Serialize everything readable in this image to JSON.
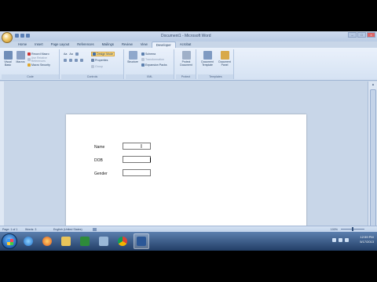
{
  "window": {
    "title": "Document1 - Microsoft Word"
  },
  "tabs": [
    "Home",
    "Insert",
    "Page Layout",
    "References",
    "Mailings",
    "Review",
    "View",
    "Developer",
    "Acrobat"
  ],
  "active_tab": "Developer",
  "ribbon": {
    "code": {
      "label": "Code",
      "visual_basic": "Visual Basic",
      "macros": "Macros",
      "record_macro": "Record Macro",
      "use_relative_references": "Use Relative References",
      "macro_security": "Macro Security"
    },
    "controls": {
      "label": "Controls",
      "design_mode": "Design Mode",
      "properties": "Properties",
      "group": "Group"
    },
    "xml": {
      "label": "XML",
      "structure": "Structure",
      "schema": "Schema",
      "transformation": "Transformation",
      "expansion_packs": "Expansion Packs"
    },
    "protect": {
      "label": "Protect",
      "protect_document": "Protect Document"
    },
    "templates": {
      "label": "Templates",
      "document_template": "Document Template",
      "document_panel": "Document Panel"
    }
  },
  "form": {
    "name_label": "Name",
    "dob_label": "DOB",
    "gender_label": "Gender"
  },
  "statusbar": {
    "page": "Page: 1 of 1",
    "words": "Words: 3",
    "language": "English (United States)",
    "zoom": "100%"
  },
  "clock": {
    "time": "12:59 PM",
    "date": "5/17/2013"
  },
  "colors": {
    "ribbon": "#eaf1fb",
    "accent": "#1e395b",
    "design_mode_highlight": "#f9d983"
  }
}
